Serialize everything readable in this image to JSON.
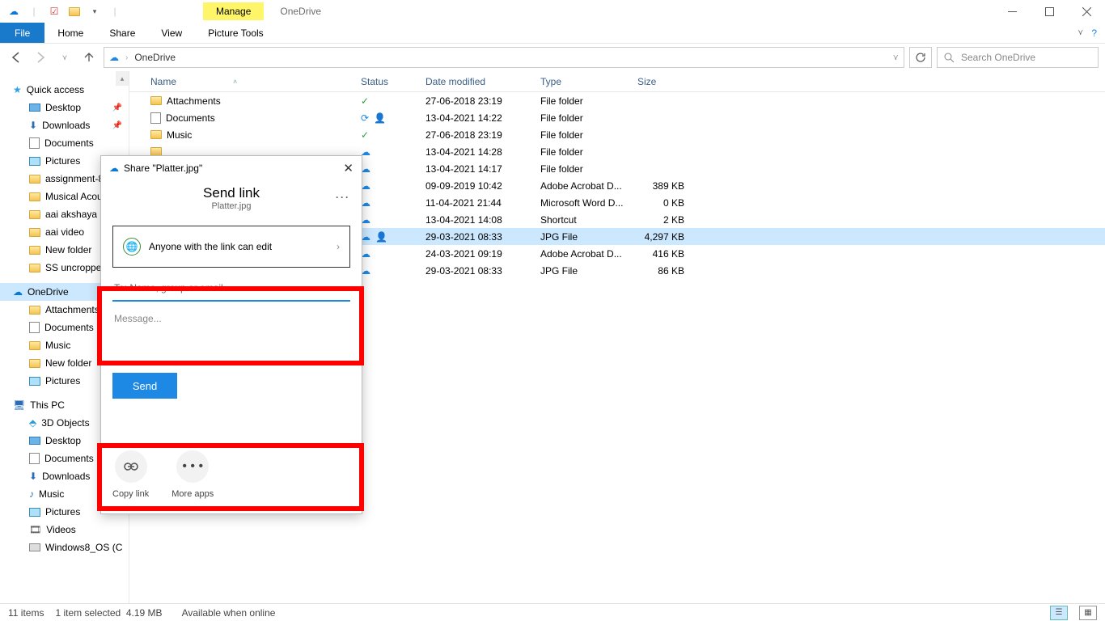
{
  "titlebar": {
    "manage_tab": "Manage",
    "context_label": "OneDrive",
    "picture_tools": "Picture Tools"
  },
  "ribbon": {
    "file": "File",
    "home": "Home",
    "share": "Share",
    "view": "View"
  },
  "nav": {
    "crumb": "OneDrive",
    "search_placeholder": "Search OneDrive"
  },
  "sidebar": {
    "quick_access": "Quick access",
    "items_qa": [
      {
        "label": "Desktop",
        "pinned": true
      },
      {
        "label": "Downloads",
        "pinned": true
      },
      {
        "label": "Documents",
        "pinned": false
      },
      {
        "label": "Pictures",
        "pinned": false
      },
      {
        "label": "assignment-8",
        "pinned": false
      },
      {
        "label": "Musical Acou",
        "pinned": false
      },
      {
        "label": "aai akshaya bi",
        "pinned": false
      },
      {
        "label": "aai video",
        "pinned": false
      },
      {
        "label": "New folder",
        "pinned": false
      },
      {
        "label": "SS uncropped",
        "pinned": false
      }
    ],
    "onedrive": "OneDrive",
    "items_od": [
      "Attachments",
      "Documents",
      "Music",
      "New folder",
      "Pictures"
    ],
    "this_pc": "This PC",
    "items_pc": [
      "3D Objects",
      "Desktop",
      "Documents",
      "Downloads",
      "Music",
      "Pictures",
      "Videos",
      "Windows8_OS (C"
    ]
  },
  "columns": {
    "name": "Name",
    "status": "Status",
    "date": "Date modified",
    "type": "Type",
    "size": "Size"
  },
  "rows": [
    {
      "name": "Attachments",
      "icon": "folder",
      "status": "ok",
      "date": "27-06-2018 23:19",
      "type": "File folder",
      "size": ""
    },
    {
      "name": "Documents",
      "icon": "doc",
      "status": "sync-person",
      "date": "13-04-2021 14:22",
      "type": "File folder",
      "size": ""
    },
    {
      "name": "Music",
      "icon": "folder",
      "status": "ok",
      "date": "27-06-2018 23:19",
      "type": "File folder",
      "size": ""
    },
    {
      "name": "",
      "icon": "folder",
      "status": "cloud",
      "date": "13-04-2021 14:28",
      "type": "File folder",
      "size": ""
    },
    {
      "name": "",
      "icon": "",
      "status": "cloud",
      "date": "13-04-2021 14:17",
      "type": "File folder",
      "size": ""
    },
    {
      "name": "",
      "icon": "",
      "status": "cloud",
      "date": "09-09-2019 10:42",
      "type": "Adobe Acrobat D...",
      "size": "389 KB"
    },
    {
      "name": "",
      "icon": "",
      "status": "cloud",
      "date": "11-04-2021 21:44",
      "type": "Microsoft Word D...",
      "size": "0 KB"
    },
    {
      "name": "",
      "icon": "",
      "status": "cloud",
      "date": "13-04-2021 14:08",
      "type": "Shortcut",
      "size": "2 KB"
    },
    {
      "name": "",
      "icon": "",
      "status": "cloud-person",
      "date": "29-03-2021 08:33",
      "type": "JPG File",
      "size": "4,297 KB",
      "selected": true
    },
    {
      "name": "",
      "icon": "",
      "status": "cloud",
      "date": "24-03-2021 09:19",
      "type": "Adobe Acrobat D...",
      "size": "416 KB"
    },
    {
      "name": "",
      "icon": "",
      "status": "cloud",
      "date": "29-03-2021 08:33",
      "type": "JPG File",
      "size": "86 KB"
    }
  ],
  "dialog": {
    "title": "Share \"Platter.jpg\"",
    "heading": "Send link",
    "subheading": "Platter.jpg",
    "scope_text": "Anyone with the link can edit",
    "to_placeholder": "To: Name, group or email",
    "msg_placeholder": "Message...",
    "send": "Send",
    "copy_link": "Copy link",
    "more_apps": "More apps"
  },
  "statusbar": {
    "items": "11 items",
    "selected": "1 item selected",
    "size": "4.19 MB",
    "availability": "Available when online"
  }
}
